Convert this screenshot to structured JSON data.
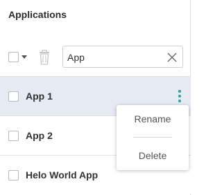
{
  "panel": {
    "title": "Applications"
  },
  "toolbar": {
    "search_value": "App"
  },
  "apps": [
    {
      "label": "App 1",
      "selected": true
    },
    {
      "label": "App 2",
      "selected": false
    },
    {
      "label": "Helo World App",
      "selected": false
    }
  ],
  "context_menu": {
    "rename": "Rename",
    "delete": "Delete"
  },
  "colors": {
    "accent": "#2aa5a0",
    "selected_row": "#e5eaf3"
  }
}
